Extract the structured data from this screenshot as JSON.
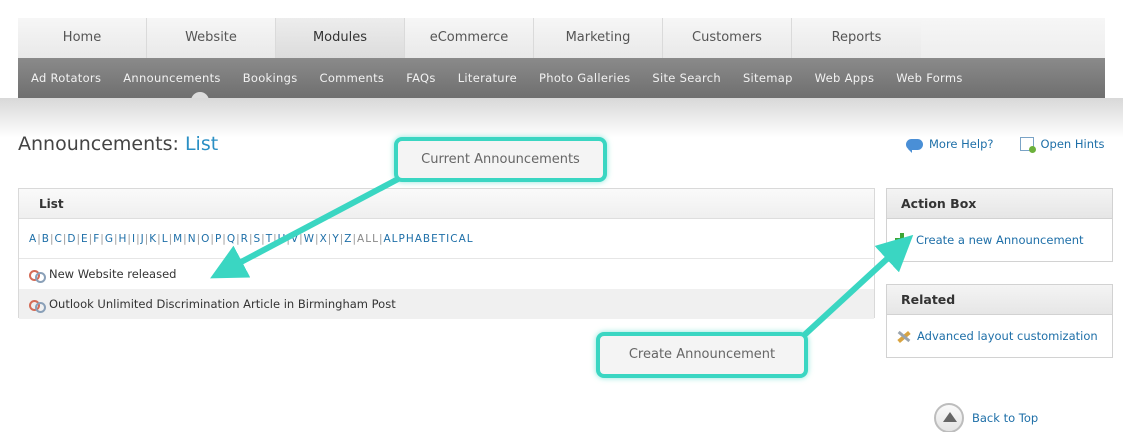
{
  "top_nav": {
    "tabs": [
      "Home",
      "Website",
      "Modules",
      "eCommerce",
      "Marketing",
      "Customers",
      "Reports"
    ],
    "active": "Modules"
  },
  "sub_nav": {
    "items": [
      "Ad Rotators",
      "Announcements",
      "Bookings",
      "Comments",
      "FAQs",
      "Literature",
      "Photo Galleries",
      "Site Search",
      "Sitemap",
      "Web Apps",
      "Web Forms"
    ],
    "active": "Announcements"
  },
  "page": {
    "title": "Announcements:",
    "subtitle": "List"
  },
  "help": {
    "more_help": "More Help?",
    "open_hints": "Open Hints"
  },
  "list_panel": {
    "header": "List",
    "letters": [
      "A",
      "B",
      "C",
      "D",
      "E",
      "F",
      "G",
      "H",
      "I",
      "J",
      "K",
      "L",
      "M",
      "N",
      "O",
      "P",
      "Q",
      "R",
      "S",
      "T",
      "U",
      "V",
      "W",
      "X",
      "Y",
      "Z"
    ],
    "all_label": "ALL",
    "alpha_label": "ALPHABETICAL",
    "rows": [
      "New Website released",
      "Outlook Unlimited Discrimination Article in Birmingham Post"
    ]
  },
  "action_box": {
    "header": "Action Box",
    "create_label": "Create a new Announcement"
  },
  "related_box": {
    "header": "Related",
    "link_label": "Advanced layout customization"
  },
  "callouts": {
    "current": "Current Announcements",
    "create": "Create Announcement"
  },
  "footer": {
    "back_to_top": "Back to Top"
  },
  "colors": {
    "accent": "#2a8fc4",
    "link": "#1e6fa8",
    "callout_border": "#3ad6c2"
  }
}
